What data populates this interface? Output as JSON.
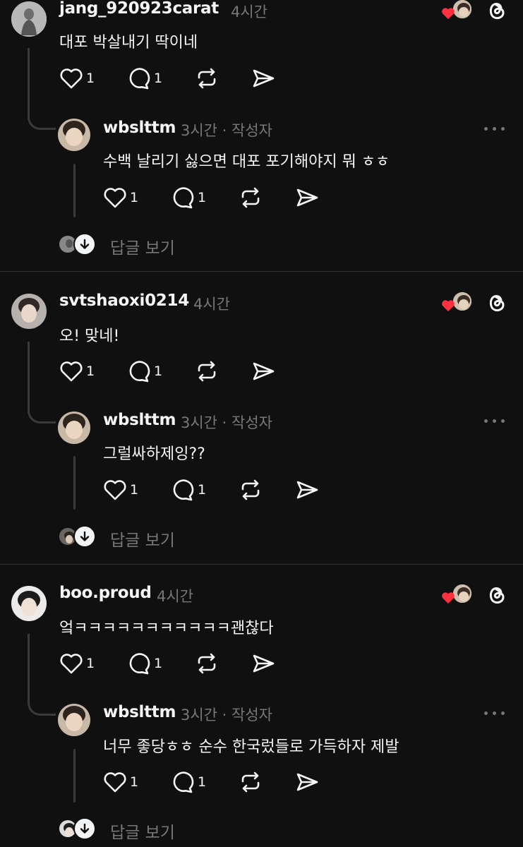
{
  "threads": [
    {
      "user": "jang_920923carat",
      "time": "4시간",
      "text": "대포 박살내기 딱이네",
      "likes": "1",
      "replies_count": "1",
      "reply": {
        "user": "wbslttm",
        "meta": "3시간 · 작성자",
        "text": "수백 날리기 싫으면 대포 포기해야지 뭐 ㅎㅎ",
        "likes": "1",
        "replies_count": "1"
      },
      "view_replies": "답글 보기"
    },
    {
      "user": "svtshaoxi0214",
      "time": "4시간",
      "text": "오! 맞네!",
      "likes": "1",
      "replies_count": "1",
      "reply": {
        "user": "wbslttm",
        "meta": "3시간 · 작성자",
        "text": "그럴싸하제잉??",
        "likes": "1",
        "replies_count": "1"
      },
      "view_replies": "답글 보기"
    },
    {
      "user": "boo.proud",
      "time": "4시간",
      "text": "엌ㅋㅋㅋㅋㅋㅋㅋㅋㅋㅋㅋ괜찮다",
      "likes": "1",
      "replies_count": "1",
      "reply": {
        "user": "wbslttm",
        "meta": "3시간 · 작성자",
        "text": "너무 좋당ㅎㅎ 순수 한국렀들로 가득하자 제발",
        "likes": "1",
        "replies_count": "1"
      },
      "view_replies": "답글 보기"
    }
  ],
  "icons": {
    "like": "heart-outline-icon",
    "comment": "speech-bubble-icon",
    "repost": "repost-icon",
    "share": "send-icon",
    "liked_by_author": "red-heart-icon",
    "platform": "threads-logo-icon",
    "more": "ellipsis-icon",
    "expand": "arrow-down-icon"
  },
  "colors": {
    "background": "#101010",
    "text": "#f3f5f7",
    "secondary_text": "#777777",
    "divider": "#323232",
    "heart": "#ff3040"
  }
}
